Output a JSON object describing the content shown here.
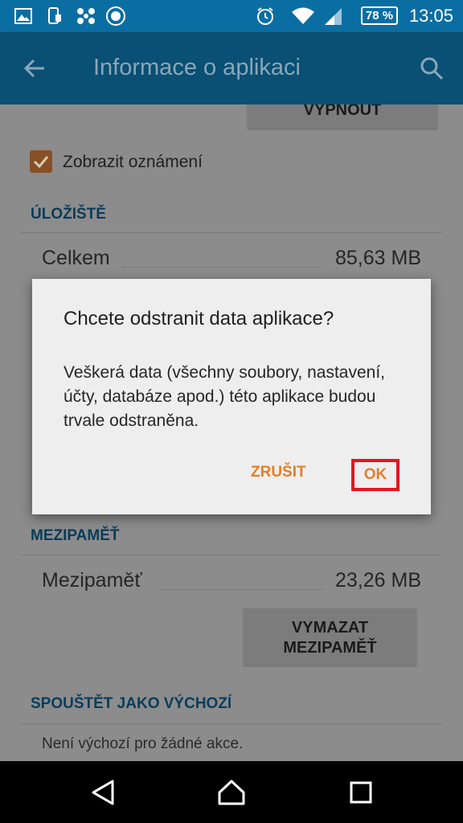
{
  "status_bar": {
    "time": "13:05",
    "battery": "78 %",
    "icons": [
      "gallery-icon",
      "phone-transfer-icon",
      "pinwheel-icon",
      "app-badge-icon",
      "alarm-icon",
      "wifi-icon",
      "signal-icon",
      "battery-icon"
    ]
  },
  "app_bar": {
    "title": "Informace o aplikaci",
    "back_icon": "arrow-left-icon",
    "search_icon": "search-icon"
  },
  "content": {
    "top_button": "VYPNOUT",
    "notifications_checkbox": {
      "label": "Zobrazit oznámení",
      "checked": true
    },
    "storage": {
      "header": "ÚLOŽIŠTĚ",
      "total_label": "Celkem",
      "total_value": "85,63 MB"
    },
    "cache": {
      "header": "MEZIPAMĚŤ",
      "label": "Mezipaměť",
      "value": "23,26 MB",
      "clear_button_line1": "VYMAZAT",
      "clear_button_line2": "MEZIPAMĚŤ"
    },
    "defaults": {
      "header": "SPOUŠTĚT JAKO VÝCHOZÍ",
      "text": "Není výchozí pro žádné akce."
    }
  },
  "dialog": {
    "title": "Chcete odstranit data aplikace?",
    "message": "Veškerá data (všechny soubory, nastavení, účty, databáze apod.) této aplikace budou trvale odstraněna.",
    "cancel_label": "ZRUŠIT",
    "ok_label": "OK"
  },
  "colors": {
    "status_bar": "#0b6ea3",
    "app_bar": "#0a4f74",
    "accent": "#e67e22",
    "highlight_box": "#e8141e"
  }
}
